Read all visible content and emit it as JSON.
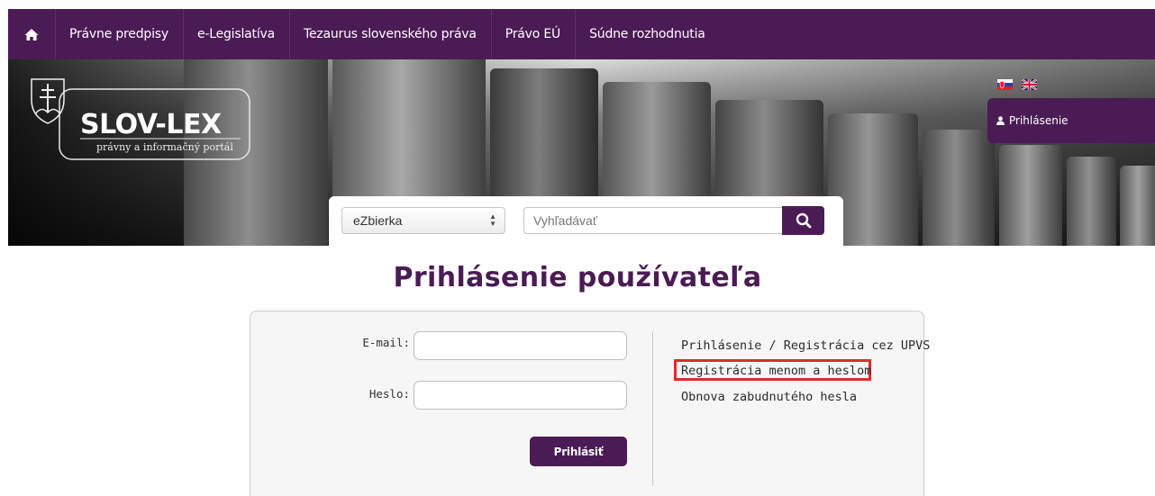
{
  "nav": {
    "home_icon": "home-icon",
    "items": [
      {
        "label": "Právne predpisy"
      },
      {
        "label": "e-Legislatíva"
      },
      {
        "label": "Tezaurus slovenského práva"
      },
      {
        "label": "Právo EÚ"
      },
      {
        "label": "Súdne rozhodnutia"
      }
    ]
  },
  "header": {
    "logo_text": "SLOV-LEX",
    "logo_subtitle": "právny a informačný portál",
    "languages": [
      "sk-flag-icon",
      "uk-flag-icon"
    ],
    "login_label": "Prihlásenie"
  },
  "search": {
    "collection_selected": "eZbierka",
    "placeholder": "Vyhľadávať",
    "search_icon": "search-icon"
  },
  "page": {
    "title": "Prihlásenie používateľa"
  },
  "login_form": {
    "email_label": "E-mail:",
    "email_value": "",
    "password_label": "Heslo:",
    "password_value": "",
    "submit_label": "Prihlásiť"
  },
  "side_links": [
    {
      "label": "Prihlásenie / Registrácia cez UPVS"
    },
    {
      "label": "Registrácia menom a heslom",
      "highlighted": true
    },
    {
      "label": "Obnova zabudnutého hesla"
    }
  ],
  "colors": {
    "brand": "#4b1b55",
    "highlight": "#e02b2b"
  }
}
